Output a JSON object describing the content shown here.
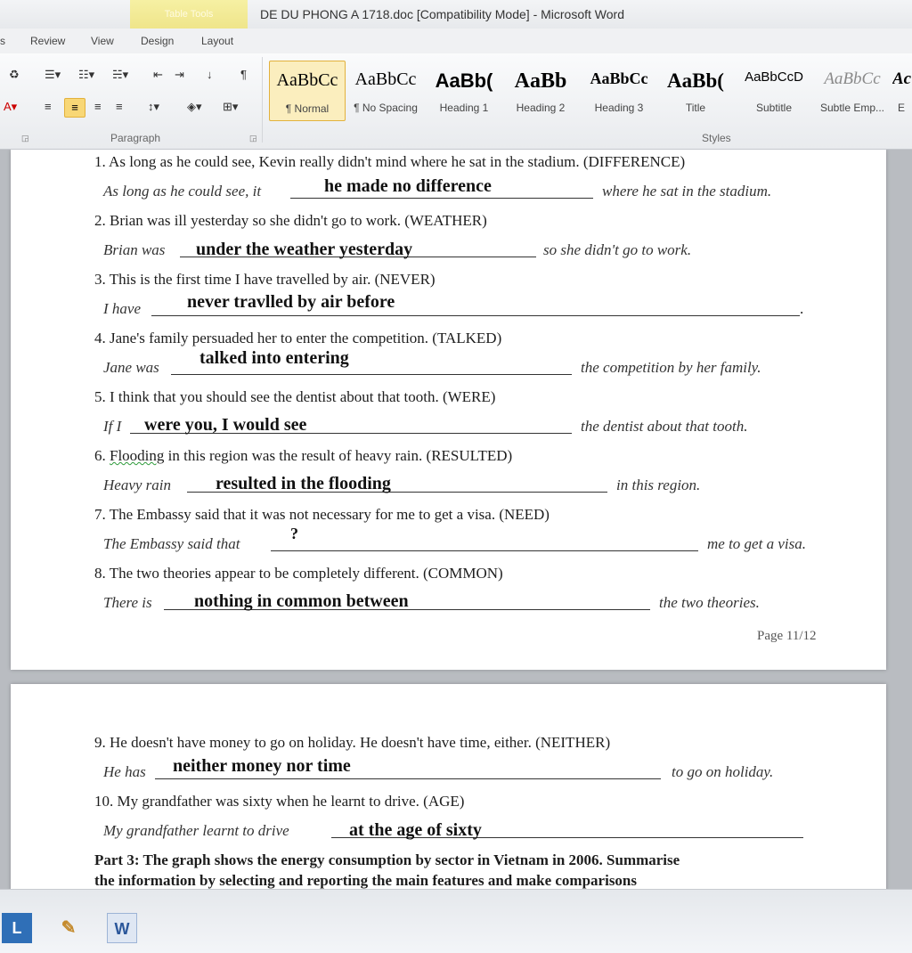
{
  "window": {
    "context_tab": "Table Tools",
    "title": "DE DU PHONG A 1718.doc [Compatibility Mode] - Microsoft Word"
  },
  "tabs": [
    "s",
    "Review",
    "View",
    "Design",
    "Layout"
  ],
  "ribbon": {
    "paragraph_label": "Paragraph",
    "styles_label": "Styles",
    "styles": [
      {
        "preview": "AaBbCc",
        "name": "¶ Normal"
      },
      {
        "preview": "AaBbCc",
        "name": "¶ No Spacing"
      },
      {
        "preview": "AaBb(",
        "name": "Heading 1"
      },
      {
        "preview": "AaBb",
        "name": "Heading 2"
      },
      {
        "preview": "AaBbCc",
        "name": "Heading 3"
      },
      {
        "preview": "AaBb(",
        "name": "Title"
      },
      {
        "preview": "AaBbCcD",
        "name": "Subtitle"
      },
      {
        "preview": "AaBbCc",
        "name": "Subtle Emp..."
      },
      {
        "preview": "Ac",
        "name": "E"
      }
    ]
  },
  "document": {
    "items": [
      {
        "q": "1. As long as he could see, Kevin really didn't mind where he sat in the stadium. (DIFFERENCE)",
        "before": "As long as he could see, it",
        "answer": "he made no difference",
        "after": "where he sat in the stadium."
      },
      {
        "q": "2. Brian was ill yesterday so she didn't go to work. (WEATHER)",
        "before": "Brian was",
        "answer": "under the weather yesterday",
        "after": "so she didn't go to work."
      },
      {
        "q": "3. This is the first time I have travelled by air. (NEVER)",
        "before": "I have",
        "answer": "never travlled by air before",
        "after": "."
      },
      {
        "q": "4. Jane's family persuaded her to enter the competition. (TALKED)",
        "before": "Jane was",
        "answer": "talked into entering",
        "after": "the competition by her family."
      },
      {
        "q": "5. I think that you should see the dentist about that tooth. (WERE)",
        "before": "If I",
        "answer": "were you, I would see",
        "after": "the dentist about that tooth."
      },
      {
        "q_word": "Flooding",
        "q": " in this region was the result of heavy rain. (RESULTED)",
        "q_num": "6. ",
        "before": "Heavy rain",
        "answer": "resulted in the flooding",
        "after": "in this region."
      },
      {
        "q": "7. The Embassy said that it was not necessary for me to get a visa. (NEED)",
        "before": "The Embassy said that",
        "answer": "?",
        "after": "me to get a visa."
      },
      {
        "q": "8. The two theories appear to be completely different. (COMMON)",
        "before": "There is",
        "answer": "nothing in common between",
        "after": "the two theories."
      }
    ],
    "page_number": "Page 11/12",
    "items2": [
      {
        "q": "9. He doesn't have money to go on holiday. He doesn't have time, either. (NEITHER)",
        "before": "He has",
        "answer": "neither money nor time",
        "after": "to go on holiday."
      },
      {
        "q": "10. My grandfather was sixty when he learnt to drive. (AGE)",
        "before": "My grandfather learnt to drive",
        "answer": "at the age of sixty",
        "after": ""
      }
    ],
    "part3_line1": "Part 3: The graph shows the energy consumption by sector in Vietnam in 2006. Summarise",
    "part3_line2": "the information by selecting and reporting the main features and make comparisons"
  },
  "taskbar": {
    "app1": "L",
    "app3": "W"
  },
  "colors": {
    "table_tools": "#efe58a",
    "selected_style": "#fbeebe",
    "taskbar_l": "#2f6fb7",
    "word_blue": "#2b579a"
  }
}
